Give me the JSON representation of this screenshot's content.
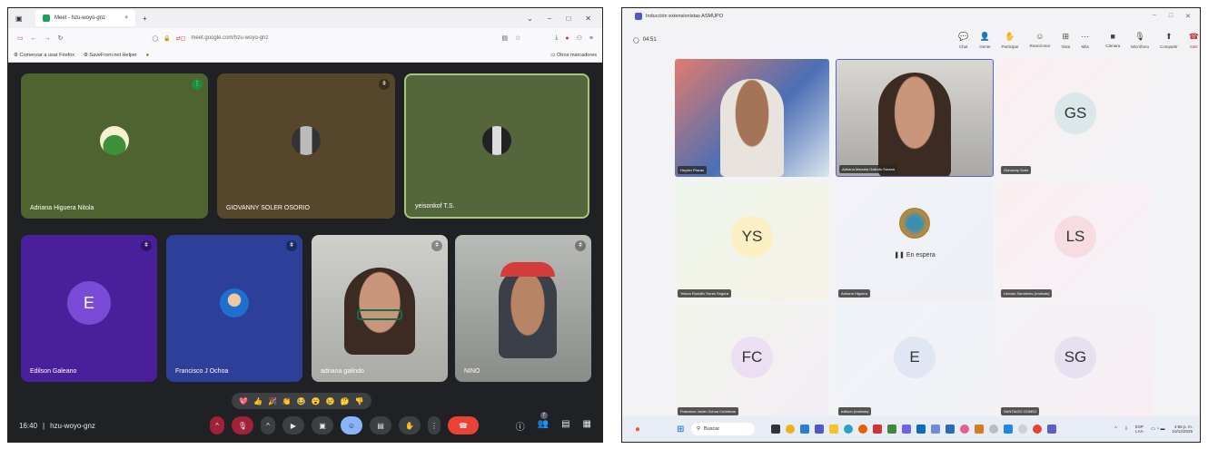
{
  "left": {
    "browser": {
      "tab_title": "Meet - hzu-woyo-gnz",
      "tab_close": "×",
      "new_tab": "+",
      "url": "meet.google.com/hzu-woyo-gnz",
      "bookmarks": [
        "Comenzar a usar Firefox",
        "SaveFrom.net Helper"
      ],
      "other_bookmarks": "Otros marcadores"
    },
    "participants": [
      {
        "name": "Adriana Higuera Nitola"
      },
      {
        "name": "GIOVANNY SOLER OSORIO"
      },
      {
        "name": "yeisonkof T.S."
      },
      {
        "name": "Edilson Galeano",
        "initial": "E"
      },
      {
        "name": "Francisco J Ochoa"
      },
      {
        "name": "adriana galindo"
      },
      {
        "name": "NINO"
      }
    ],
    "reactions": [
      "💖",
      "👍",
      "🎉",
      "👏",
      "😂",
      "😮",
      "😢",
      "🤔",
      "👎"
    ],
    "time": "16:40",
    "meeting_code": "hzu-woyo-gnz",
    "people_count": "7"
  },
  "right": {
    "window_title": "Inducción extensionistas ASMUPO",
    "timer": "04:51",
    "tools": [
      "Chat",
      "Gente",
      "Participar",
      "Reaccionar",
      "Vista",
      "Más",
      "Cámara",
      "Micrófono",
      "Compartir",
      "Salir"
    ],
    "tiles": [
      {
        "name": "Heyder Plazas"
      },
      {
        "name": "Adriana Marcela Galindo Soracá"
      },
      {
        "name": "Giovanny Soler",
        "initials": "GS"
      },
      {
        "name": "Yeison Rodolfo Torres Segura",
        "initials": "YS"
      },
      {
        "name": "Adriana Higuera",
        "status": "En espera"
      },
      {
        "name": "Libardo Sarmiento (Invitado)",
        "initials": "LS"
      },
      {
        "name": "Francisco Javier Ochoa Contreras",
        "initials": "FC"
      },
      {
        "name": "edilson (Invitado)",
        "initials": "E"
      },
      {
        "name": "SANTIAGO GOMEZ",
        "initials": "SG"
      }
    ],
    "taskbar": {
      "search_placeholder": "Buscar",
      "lang": "ESP",
      "lang2": "LAA",
      "time": "4:56 p. m.",
      "date": "10/12/2025"
    }
  }
}
